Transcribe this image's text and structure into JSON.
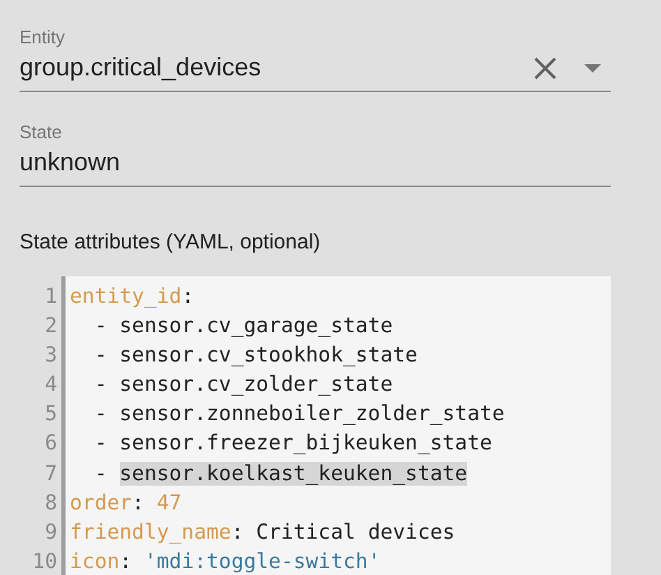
{
  "entity_field": {
    "label": "Entity",
    "value": "group.critical_devices",
    "clearable": true,
    "has_dropdown": true
  },
  "state_field": {
    "label": "State",
    "value": "unknown"
  },
  "attributes": {
    "label": "State attributes (YAML, optional)",
    "lines": [
      {
        "number": "1",
        "tokens": [
          {
            "kind": "key",
            "text": "entity_id",
            "selected": false
          },
          {
            "kind": "punct",
            "text": ":",
            "selected": false
          }
        ]
      },
      {
        "number": "2",
        "tokens": [
          {
            "kind": "plain",
            "text": "  - ",
            "selected": false
          },
          {
            "kind": "plain",
            "text": "sensor.cv_garage_state",
            "selected": false
          }
        ]
      },
      {
        "number": "3",
        "tokens": [
          {
            "kind": "plain",
            "text": "  - ",
            "selected": false
          },
          {
            "kind": "plain",
            "text": "sensor.cv_stookhok_state",
            "selected": false
          }
        ]
      },
      {
        "number": "4",
        "tokens": [
          {
            "kind": "plain",
            "text": "  - ",
            "selected": false
          },
          {
            "kind": "plain",
            "text": "sensor.cv_zolder_state",
            "selected": false
          }
        ]
      },
      {
        "number": "5",
        "tokens": [
          {
            "kind": "plain",
            "text": "  - ",
            "selected": false
          },
          {
            "kind": "plain",
            "text": "sensor.zonneboiler_zolder_state",
            "selected": false
          }
        ]
      },
      {
        "number": "6",
        "tokens": [
          {
            "kind": "plain",
            "text": "  - ",
            "selected": false
          },
          {
            "kind": "plain",
            "text": "sensor.freezer_bijkeuken_state",
            "selected": false
          }
        ]
      },
      {
        "number": "7",
        "tokens": [
          {
            "kind": "plain",
            "text": "  - ",
            "selected": false
          },
          {
            "kind": "plain",
            "text": "sensor.koelkast_keuken_state",
            "selected": true
          }
        ]
      },
      {
        "number": "8",
        "tokens": [
          {
            "kind": "key",
            "text": "order",
            "selected": false
          },
          {
            "kind": "punct",
            "text": ": ",
            "selected": false
          },
          {
            "kind": "number",
            "text": "47",
            "selected": false
          }
        ]
      },
      {
        "number": "9",
        "tokens": [
          {
            "kind": "key",
            "text": "friendly_name",
            "selected": false
          },
          {
            "kind": "punct",
            "text": ": ",
            "selected": false
          },
          {
            "kind": "plain",
            "text": "Critical devices",
            "selected": false
          }
        ]
      },
      {
        "number": "10",
        "tokens": [
          {
            "kind": "key",
            "text": "icon",
            "selected": false
          },
          {
            "kind": "punct",
            "text": ": ",
            "selected": false
          },
          {
            "kind": "string",
            "text": "'mdi:toggle-switch'",
            "selected": false
          }
        ]
      }
    ]
  }
}
